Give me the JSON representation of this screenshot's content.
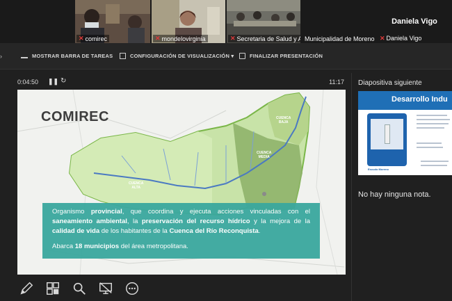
{
  "participants": [
    {
      "name": "comirec",
      "muted": true
    },
    {
      "name": "mondelovirginia",
      "muted": true
    },
    {
      "name": "Secretaria de Salud y A...",
      "muted": true
    },
    {
      "name": "Municipalidad de Moreno",
      "muted": false
    },
    {
      "name": "Daniela Vigo",
      "muted": true,
      "display_name": "Daniela Vigo"
    }
  ],
  "toolbar": {
    "show_taskbar": "MOSTRAR BARRA DE TAREAS",
    "display_settings": "CONFIGURACIÓN DE VISUALIZACIÓN ▾",
    "end_presentation": "FINALIZAR PRESENTACIÓN"
  },
  "timer": {
    "elapsed": "0:04:50",
    "clock": "11:17"
  },
  "slide": {
    "title": "COMIREC",
    "map_labels": {
      "alta": "CUENCA\nALTA",
      "media": "CUENCA\nMEDIA",
      "baja": "CUENCA\nBAJA"
    },
    "paragraph_1_parts": [
      "Organismo ",
      "provincial",
      ", que coordina y ejecuta acciones vinculadas con el ",
      "saneamiento ambiental",
      ", la ",
      "preservación del recurso hídrico",
      " y la mejora de la ",
      "calidad de vida",
      " de los habitantes de la ",
      "Cuenca del Río Reconquista",
      "."
    ],
    "paragraph_2_parts": [
      "Abarca ",
      "18 municipios",
      " del área metropolitana."
    ]
  },
  "next_slide": {
    "label": "Diapositiva siguiente",
    "title": "Desarrollo Indu",
    "caption": "Escudo Moreno"
  },
  "notes": {
    "text": "No hay ninguna nota."
  },
  "colors": {
    "accent_teal": "#3aa89e",
    "next_slide_blue": "#1f6fb6",
    "mic_off": "#e03a3a"
  },
  "tools": [
    "pen-icon",
    "slides-grid-icon",
    "zoom-icon",
    "black-screen-icon",
    "more-options-icon"
  ]
}
